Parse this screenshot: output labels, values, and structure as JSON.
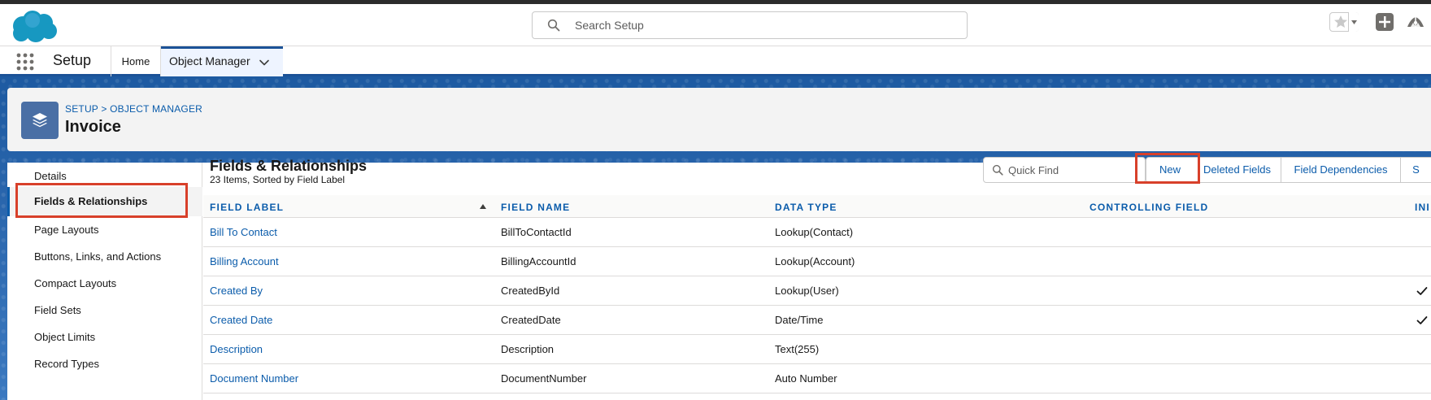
{
  "header": {
    "search_placeholder": "Search Setup"
  },
  "navbar": {
    "app_name": "Setup",
    "tabs": [
      {
        "label": "Home"
      },
      {
        "label": "Object Manager"
      }
    ]
  },
  "object_header": {
    "breadcrumb_setup": "SETUP",
    "breadcrumb_sep": ">",
    "breadcrumb_object_manager": "OBJECT MANAGER",
    "title": "Invoice"
  },
  "left_nav": {
    "items": [
      {
        "label": "Details"
      },
      {
        "label": "Fields & Relationships"
      },
      {
        "label": "Page Layouts"
      },
      {
        "label": "Buttons, Links, and Actions"
      },
      {
        "label": "Compact Layouts"
      },
      {
        "label": "Field Sets"
      },
      {
        "label": "Object Limits"
      },
      {
        "label": "Record Types"
      }
    ]
  },
  "fields": {
    "title": "Fields & Relationships",
    "subtitle": "23 Items, Sorted by Field Label",
    "quick_find_placeholder": "Quick Find",
    "buttons": {
      "new": "New",
      "deleted_fields": "Deleted Fields",
      "field_dependencies": "Field Dependencies",
      "set_history_tracking": "S"
    },
    "columns": {
      "field_label": "FIELD LABEL",
      "field_name": "FIELD NAME",
      "data_type": "DATA TYPE",
      "controlling_field": "CONTROLLING FIELD",
      "indexed": "INI"
    },
    "rows": [
      {
        "label": "Bill To Contact",
        "name": "BillToContactId",
        "type": "Lookup(Contact)",
        "controlling": "",
        "indexed": false
      },
      {
        "label": "Billing Account",
        "name": "BillingAccountId",
        "type": "Lookup(Account)",
        "controlling": "",
        "indexed": false
      },
      {
        "label": "Created By",
        "name": "CreatedById",
        "type": "Lookup(User)",
        "controlling": "",
        "indexed": true
      },
      {
        "label": "Created Date",
        "name": "CreatedDate",
        "type": "Date/Time",
        "controlling": "",
        "indexed": true
      },
      {
        "label": "Description",
        "name": "Description",
        "type": "Text(255)",
        "controlling": "",
        "indexed": false
      },
      {
        "label": "Document Number",
        "name": "DocumentNumber",
        "type": "Auto Number",
        "controlling": "",
        "indexed": false
      }
    ]
  },
  "colors": {
    "brand_blue": "#1b5297",
    "link_blue": "#0b5cab",
    "highlight_red": "#d8402a"
  }
}
